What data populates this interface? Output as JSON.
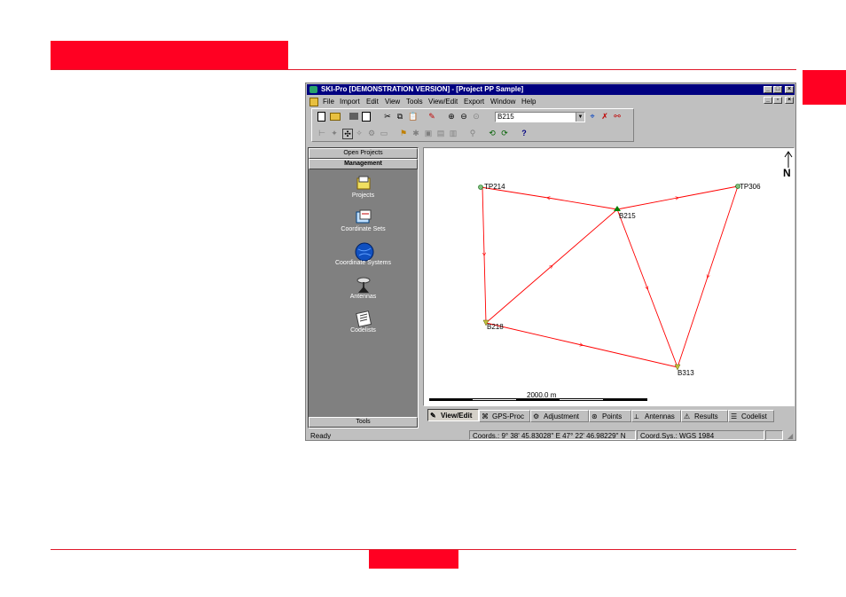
{
  "window": {
    "title": "SKI-Pro [DEMONSTRATION VERSION] - [Project PP Sample]",
    "title_buttons": [
      "_",
      "□",
      "×"
    ],
    "child_buttons": [
      "_",
      "▫",
      "×"
    ]
  },
  "menu": [
    "File",
    "Import",
    "Edit",
    "View",
    "Tools",
    "View/Edit",
    "Export",
    "Window",
    "Help"
  ],
  "toolbar": {
    "point_selector_value": "B215",
    "row1_icons": [
      "new-icon",
      "open-icon",
      "print-icon",
      "print-preview-icon",
      "cut-icon",
      "copy-icon",
      "paste-icon",
      "properties-icon",
      "zoom-in-icon",
      "zoom-out-icon",
      "zoom-all-icon"
    ],
    "row2_icons": [
      "tool-a-icon",
      "tool-b-icon",
      "tool-c-icon",
      "tool-d-icon",
      "tool-e-icon",
      "tool-f-icon",
      "tool-g-icon",
      "tool-h-icon",
      "tool-i-icon",
      "tool-j-icon",
      "tool-k-icon",
      "tool-l-icon",
      "tool-m-icon",
      "tool-n-icon",
      "help-icon"
    ]
  },
  "left_panel": {
    "open_projects": "Open Projects",
    "management": "Management",
    "tools": "Tools",
    "items": [
      {
        "label": "Projects",
        "icon": "projects-icon"
      },
      {
        "label": "Coordinate Sets",
        "icon": "coordinate-sets-icon"
      },
      {
        "label": "Coordinate Systems",
        "icon": "globe-icon"
      },
      {
        "label": "Antennas",
        "icon": "antenna-icon"
      },
      {
        "label": "Codelists",
        "icon": "codelist-icon"
      }
    ]
  },
  "map": {
    "north_label": "N",
    "scale_label": "2000.0 m",
    "points": [
      {
        "name": "TP214"
      },
      {
        "name": "B215"
      },
      {
        "name": "TP306"
      },
      {
        "name": "B218"
      },
      {
        "name": "B313"
      }
    ],
    "line_color": "#ff0000"
  },
  "tabs": [
    {
      "label": "View/Edit",
      "active": true
    },
    {
      "label": "GPS-Proc",
      "active": false
    },
    {
      "label": "Adjustment",
      "active": false
    },
    {
      "label": "Points",
      "active": false
    },
    {
      "label": "Antennas",
      "active": false
    },
    {
      "label": "Results",
      "active": false
    },
    {
      "label": "Codelist",
      "active": false
    }
  ],
  "status": {
    "ready": "Ready",
    "coords": "Coords.:   9° 38' 45.83028'' E   47° 22' 46.98229'' N",
    "coord_sys": "Coord.Sys.: WGS 1984"
  }
}
